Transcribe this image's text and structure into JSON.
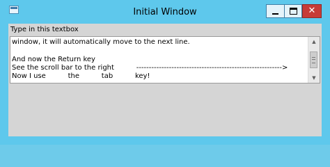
{
  "window": {
    "title": "Initial Window",
    "controls": {
      "minimize": "minimize",
      "maximize": "maximize",
      "close": "✕"
    }
  },
  "label": "Type in this textbox",
  "textbox": {
    "lines": [
      "window, it will automatically move to the next line.",
      "",
      "And now the Return key",
      "See the scroll bar to the right          ---------------------------------------------------------->",
      "Now I use          the          tab          key!"
    ]
  },
  "icons": {
    "app": "app-window-icon",
    "scroll_up": "scroll-up-arrow-icon",
    "scroll_down": "scroll-down-arrow-icon"
  },
  "colors": {
    "title_bar": "#5ec8ec",
    "close_button": "#c73b37",
    "client_area": "#d5d5d5",
    "textbox_bg": "#ffffff"
  }
}
